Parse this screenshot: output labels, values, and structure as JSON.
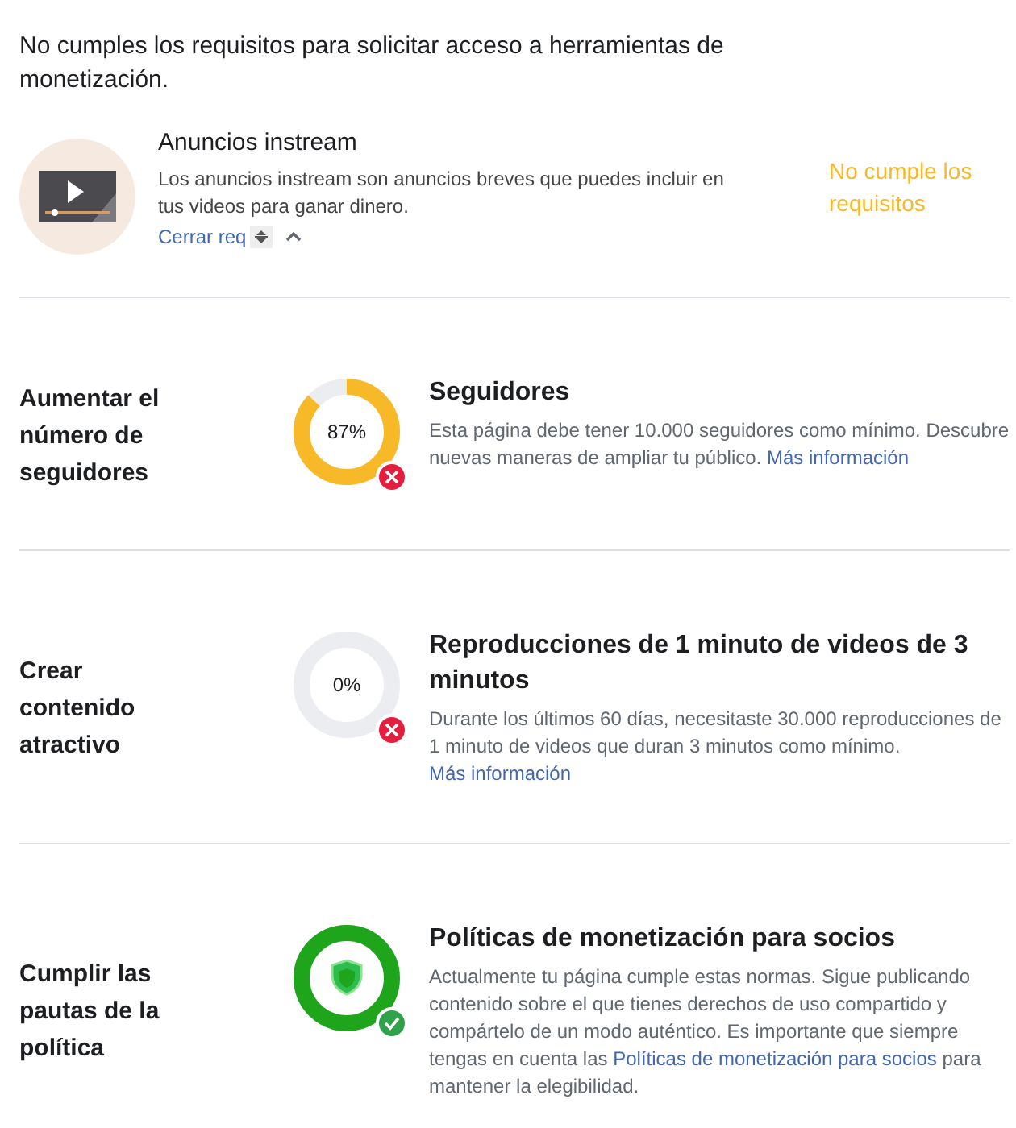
{
  "notice": "No cumples los requisitos para solicitar acceso a herramientas de monetización.",
  "tool": {
    "title": "Anuncios instream",
    "description": "Los anuncios instream son anuncios breves que puedes incluir en tus videos para ganar dinero.",
    "toggle": "Cerrar req",
    "status": "No cumple los requisitos"
  },
  "requirements": [
    {
      "goal": "Aumentar el número de seguidores",
      "met": false,
      "percent": "87%",
      "title": "Seguidores",
      "text": "Esta página debe tener 10.000 seguidores como mínimo. Descubre nuevas maneras de ampliar tu público.",
      "link": "Más información"
    },
    {
      "goal": "Crear contenido atractivo",
      "met": false,
      "percent": "0%",
      "title": "Reproducciones de 1 minuto de videos de 3 minutos",
      "text": "Durante los últimos 60 días, necesitaste 30.000 reproducciones de 1 minuto de videos que duran 3 minutos como mínimo.",
      "link": "Más información"
    },
    {
      "goal": "Cumplir las pautas de la política",
      "met": true,
      "title": "Políticas de monetización para socios",
      "text": "Actualmente tu página cumple estas normas. Sigue publicando contenido sobre el que tienes derechos de uso compartido y compártelo de un modo auténtico. Es importante que siempre tengas en cuenta las",
      "link": "Políticas de monetización para socios",
      "text_after": "para mantener la elegibilidad."
    }
  ]
}
